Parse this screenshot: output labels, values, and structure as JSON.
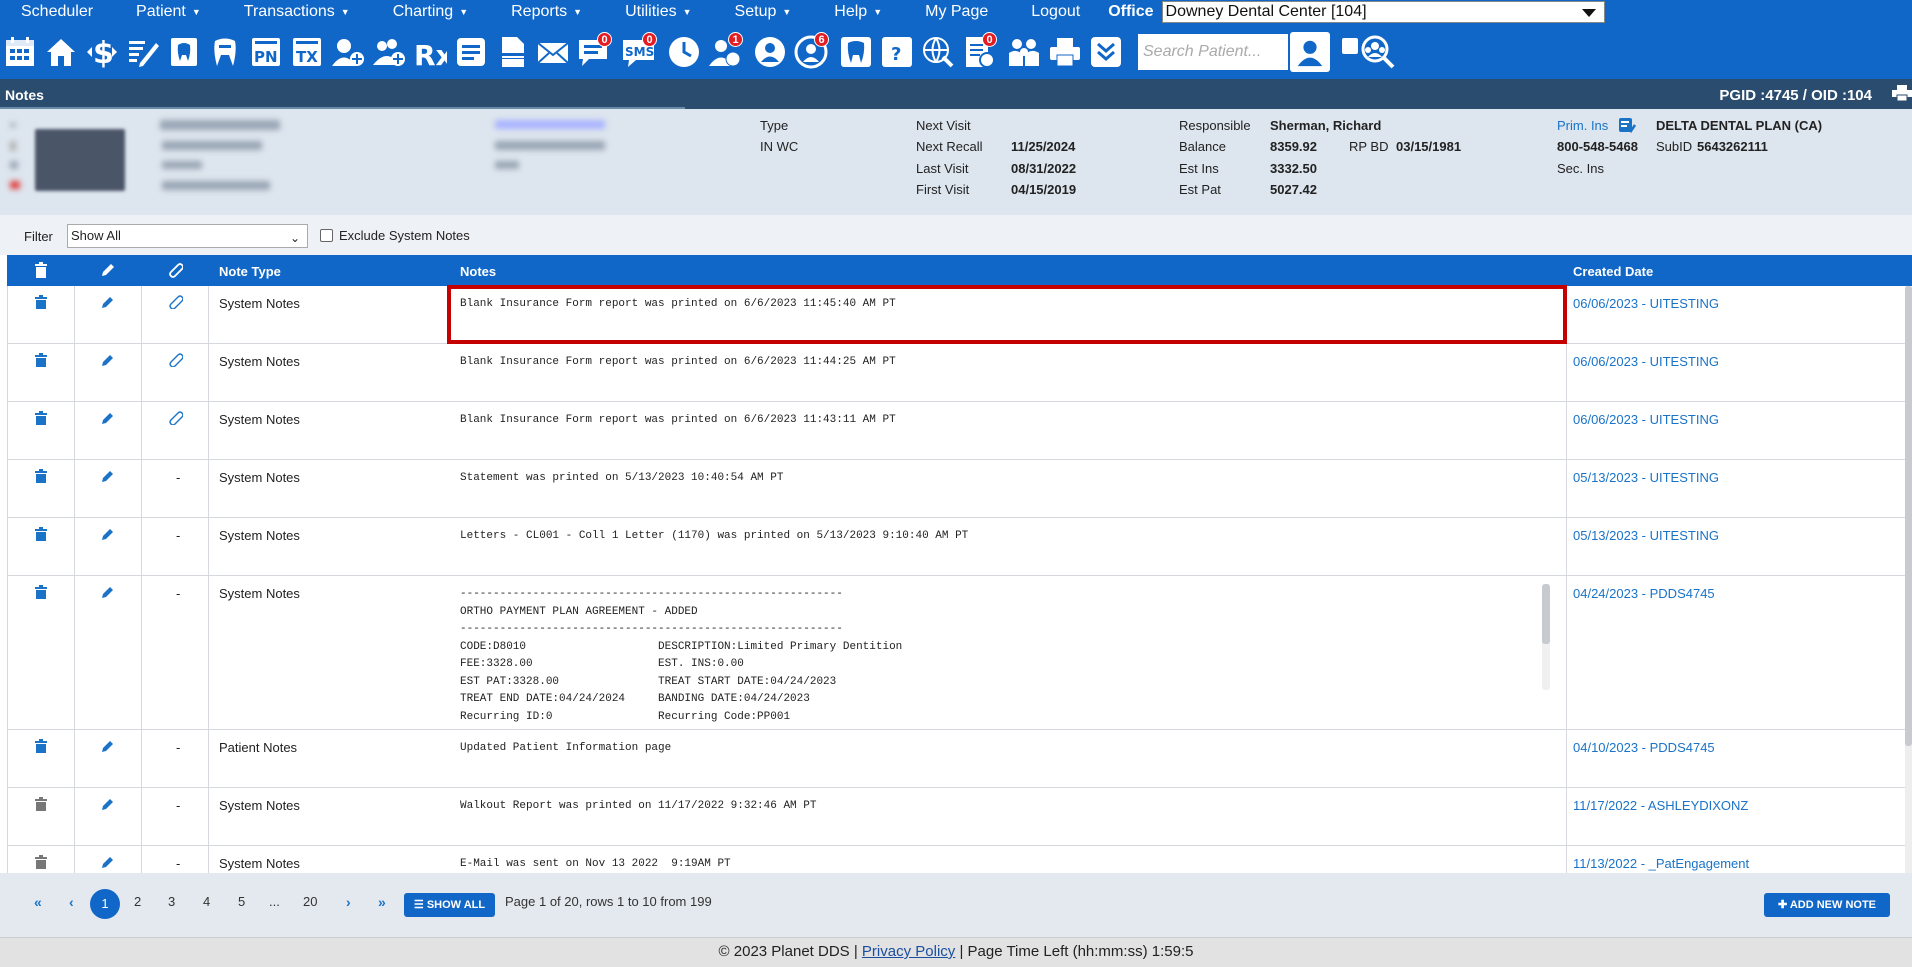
{
  "nav": {
    "items": [
      {
        "label": "Scheduler",
        "caret": false
      },
      {
        "label": "Patient",
        "caret": true
      },
      {
        "label": "Transactions",
        "caret": true
      },
      {
        "label": "Charting",
        "caret": true
      },
      {
        "label": "Reports",
        "caret": true
      },
      {
        "label": "Utilities",
        "caret": true
      },
      {
        "label": "Setup",
        "caret": true
      },
      {
        "label": "Help",
        "caret": true
      },
      {
        "label": "My Page",
        "caret": false
      },
      {
        "label": "Logout",
        "caret": false
      }
    ],
    "office_label": "Office",
    "office_value": "Downey Dental Center [104]"
  },
  "toolbar": {
    "badges": {
      "text": "0",
      "sms": "0",
      "globe_people": "1",
      "support": "6",
      "checklist": "0"
    },
    "sms_label": "SMS",
    "pn_label": "PN",
    "tx_label": "TX",
    "rx_label": "Rx",
    "search_placeholder": "Search Patient..."
  },
  "titlebar": {
    "title": "Notes",
    "ids": "PGID :4745  /  OID :104"
  },
  "patient": {
    "type_label": "Type",
    "type_value": "IN WC",
    "next_visit_label": "Next Visit",
    "next_visit_value": "",
    "next_recall_label": "Next Recall",
    "next_recall_value": "11/25/2024",
    "last_visit_label": "Last Visit",
    "last_visit_value": "08/31/2022",
    "first_visit_label": "First Visit",
    "first_visit_value": "04/15/2019",
    "responsible_label": "Responsible",
    "responsible_value": "Sherman, Richard",
    "balance_label": "Balance",
    "balance_value": "8359.92",
    "rpbd_label": "RP BD",
    "rpbd_value": "03/15/1981",
    "est_ins_label": "Est Ins",
    "est_ins_value": "3332.50",
    "est_pat_label": "Est Pat",
    "est_pat_value": "5027.42",
    "prim_ins_label": "Prim. Ins",
    "prim_ins_value": "DELTA DENTAL PLAN (CA)",
    "phone": "800-548-5468",
    "subid_label": "SubID",
    "subid_value": "5643262111",
    "sec_ins_label": "Sec. Ins"
  },
  "filter": {
    "label": "Filter",
    "value": "Show All",
    "exclude_label": "Exclude System Notes"
  },
  "table": {
    "headers": {
      "note_type": "Note Type",
      "notes": "Notes",
      "created": "Created Date"
    },
    "rows": [
      {
        "attach": true,
        "type": "System Notes",
        "notes": "Blank Insurance Form report was printed on 6/6/2023 11:45:40 AM PT",
        "created": "06/06/2023 - UITESTING"
      },
      {
        "attach": true,
        "type": "System Notes",
        "notes": "Blank Insurance Form report was printed on 6/6/2023 11:44:25 AM PT",
        "created": "06/06/2023 - UITESTING"
      },
      {
        "attach": true,
        "type": "System Notes",
        "notes": "Blank Insurance Form report was printed on 6/6/2023 11:43:11 AM PT",
        "created": "06/06/2023 - UITESTING"
      },
      {
        "attach": false,
        "type": "System Notes",
        "notes": "Statement was printed on 5/13/2023 10:40:54 AM PT",
        "created": "05/13/2023 - UITESTING"
      },
      {
        "attach": false,
        "type": "System Notes",
        "notes": "Letters - CL001 - Coll 1 Letter (1170) was printed on 5/13/2023 9:10:40 AM PT",
        "created": "05/13/2023 - UITESTING"
      },
      {
        "attach": false,
        "type": "System Notes",
        "notes": "----------------------------------------------------------\nORTHO PAYMENT PLAN AGREEMENT - ADDED\n----------------------------------------------------------\nCODE:D8010                    DESCRIPTION:Limited Primary Dentition\nFEE:3328.00                   EST. INS:0.00\nEST PAT:3328.00               TREAT START DATE:04/24/2023\nTREAT END DATE:04/24/2024     BANDING DATE:04/24/2023\nRecurring ID:0                Recurring Code:PP001",
        "created": "04/24/2023 - PDDS4745",
        "tall": true
      },
      {
        "attach": false,
        "type": "Patient Notes",
        "notes": "Updated Patient Information page",
        "created": "04/10/2023 - PDDS4745"
      },
      {
        "attach": false,
        "type": "System Notes",
        "notes": "Walkout Report was printed on 11/17/2022 9:32:46 AM PT",
        "created": "11/17/2022 - ASHLEYDIXONZ",
        "grey_trash": true
      },
      {
        "attach": false,
        "type": "System Notes",
        "notes": "E-Mail was sent on Nov 13 2022  9:19AM PT",
        "created": "11/13/2022 - _PatEngagement",
        "grey_trash": true
      }
    ],
    "dash": "-"
  },
  "pager": {
    "first": "«",
    "prev": "‹",
    "next": "›",
    "last": "»",
    "pages": [
      "1",
      "2",
      "3",
      "4",
      "5",
      "...",
      "20"
    ],
    "show_all": "SHOW ALL",
    "info": "Page 1 of 20, rows 1 to 10 from 199",
    "add_new": "ADD NEW NOTE"
  },
  "footer": {
    "copyright": "© 2023 Planet DDS |",
    "privacy": "Privacy Policy",
    "time_left": "|  Page Time Left (hh:mm:ss) 1:59:5"
  },
  "colors": {
    "nav_blue": "#1067c7",
    "title_bar": "#2a4c6e",
    "highlight_red": "#c40000",
    "link_blue": "#1a73c7"
  }
}
